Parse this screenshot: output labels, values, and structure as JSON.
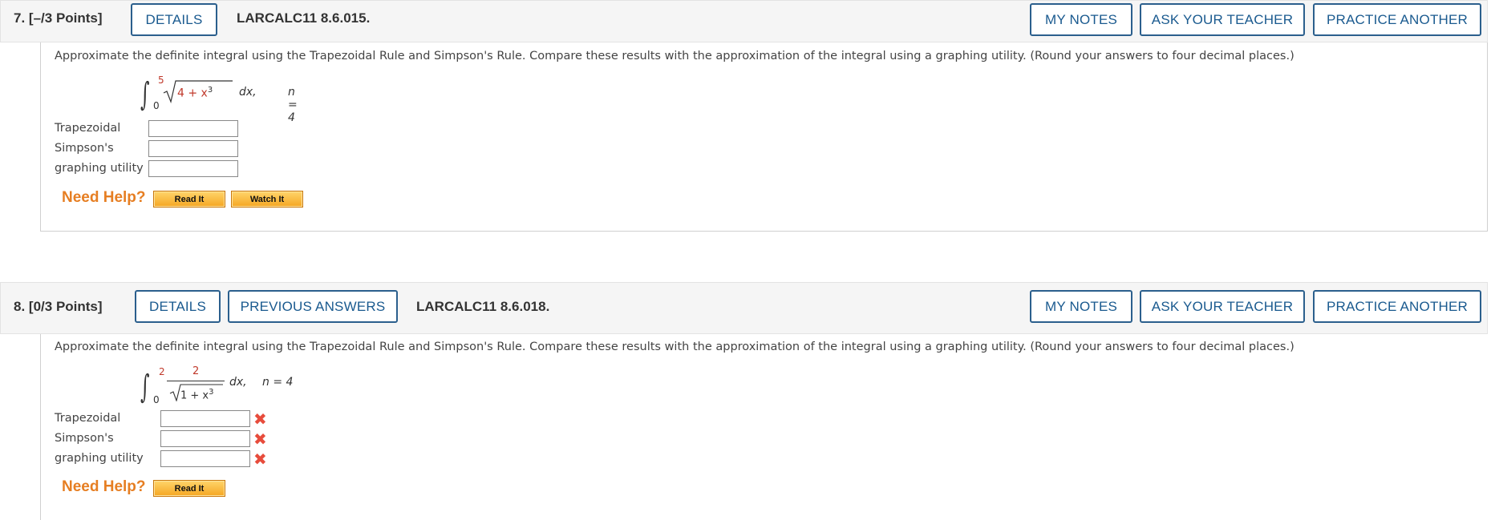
{
  "questions": [
    {
      "number": "7.",
      "points": "[–/3 Points]",
      "details_label": "DETAILS",
      "code": "LARCALC11 8.6.015.",
      "my_notes_label": "MY NOTES",
      "ask_teacher_label": "ASK YOUR TEACHER",
      "practice_label": "PRACTICE ANOTHER",
      "prompt": "Approximate the definite integral using the Trapezoidal Rule and Simpson's Rule. Compare these results with the approximation of the integral using a graphing utility. (Round your answers to four decimal places.)",
      "integral": {
        "lower": "0",
        "upper": "5",
        "radicand": "4 + x",
        "exponent": "3",
        "dx": "dx,",
        "n": "n = 4"
      },
      "labels": [
        "Trapezoidal",
        "Simpson's",
        "graphing utility"
      ],
      "values": [
        "",
        "",
        ""
      ],
      "need_help": "Need Help?",
      "read_it": "Read It",
      "watch_it": "Watch It"
    },
    {
      "number": "8.",
      "points": "[0/3 Points]",
      "details_label": "DETAILS",
      "prev_answers_label": "PREVIOUS ANSWERS",
      "code": "LARCALC11 8.6.018.",
      "my_notes_label": "MY NOTES",
      "ask_teacher_label": "ASK YOUR TEACHER",
      "practice_label": "PRACTICE ANOTHER",
      "prompt": "Approximate the definite integral using the Trapezoidal Rule and Simpson's Rule. Compare these results with the approximation of the integral using a graphing utility. (Round your answers to four decimal places.)",
      "integral": {
        "lower": "0",
        "upper": "2",
        "numerator": "2",
        "radicand": "1 + x",
        "exponent": "3",
        "dx": "dx,",
        "n": "n = 4"
      },
      "labels": [
        "Trapezoidal",
        "Simpson's",
        "graphing utility"
      ],
      "values": [
        "",
        "",
        ""
      ],
      "need_help": "Need Help?",
      "read_it": "Read It",
      "status_icon": "x-mark-icon"
    }
  ]
}
